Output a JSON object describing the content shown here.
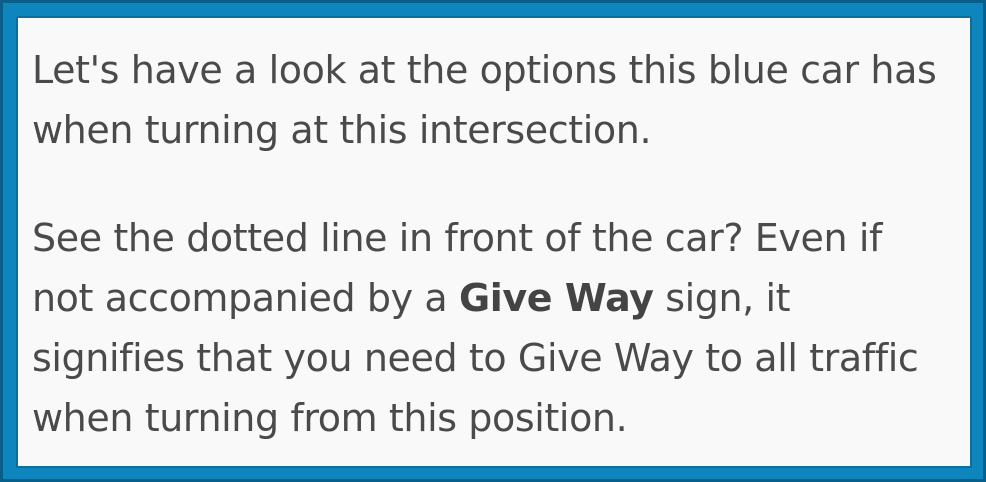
{
  "paragraph_1": {
    "line_1": "Let's have a look at the options this blue car has",
    "line_2": "when turning at this intersection."
  },
  "paragraph_2": {
    "line_1": "See the dotted line in front of the car? Even if",
    "line_2_before": "not accompanied by a ",
    "line_2_bold": "Give Way",
    "line_2_after": " sign, it",
    "line_3": "signifies that you need to Give Way to all traffic",
    "line_4": "when turning from this position."
  },
  "colors": {
    "frame": "#0e86bd",
    "frame_border": "#0a5f8a",
    "panel_background": "#f9f9f9",
    "text": "#4a4a4a"
  }
}
